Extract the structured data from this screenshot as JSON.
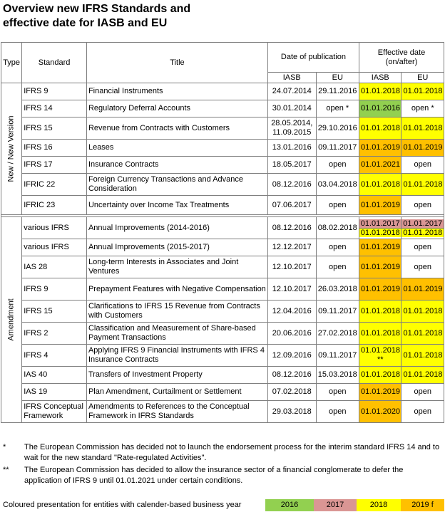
{
  "title_line1": "Overview new IFRS Standards and",
  "title_line2": "effective date for IASB and EU",
  "headers": {
    "type": "Type",
    "standard": "Standard",
    "title": "Title",
    "pub": "Date of publication",
    "eff": "Effective date (on/after)",
    "iasb": "IASB",
    "eu": "EU"
  },
  "groups": {
    "new": "New / New Version",
    "amend": "Amendment"
  },
  "colors": {
    "2016": "#92d050",
    "2017": "#da9694",
    "2018": "#ffff00",
    "2019f": "#ffc000"
  },
  "rows_new": [
    {
      "std": "IFRS 9",
      "title": "Financial Instruments",
      "pub_iasb": "24.07.2014",
      "pub_eu": "29.11.2016",
      "eff_iasb": "01.01.2018",
      "eff_iasb_c": "y2018",
      "eff_eu": "01.01.2018",
      "eff_eu_c": "y2018"
    },
    {
      "std": "IFRS 14",
      "title": "Regulatory Deferral Accounts",
      "pub_iasb": "30.01.2014",
      "pub_eu": "open *",
      "eff_iasb": "01.01.2016",
      "eff_iasb_c": "y2016",
      "eff_eu": "open *",
      "eff_eu_c": ""
    },
    {
      "std": "IFRS 15",
      "title": "Revenue from Contracts with Customers",
      "pub_iasb": "28.05.2014, 11.09.2015",
      "pub_eu": "29.10.2016",
      "eff_iasb": "01.01.2018",
      "eff_iasb_c": "y2018",
      "eff_eu": "01.01.2018",
      "eff_eu_c": "y2018"
    },
    {
      "std": "IFRS 16",
      "title": "Leases",
      "pub_iasb": "13.01.2016",
      "pub_eu": "09.11.2017",
      "eff_iasb": "01.01.2019",
      "eff_iasb_c": "y2019",
      "eff_eu": "01.01.2019",
      "eff_eu_c": "y2019"
    },
    {
      "std": "IFRS 17",
      "title": "Insurance Contracts",
      "pub_iasb": "18.05.2017",
      "pub_eu": "open",
      "eff_iasb": "01.01.2021",
      "eff_iasb_c": "y2021",
      "eff_eu": "open",
      "eff_eu_c": ""
    },
    {
      "std": "IFRIC 22",
      "title": "Foreign Currency Transactions and Advance Consideration",
      "pub_iasb": "08.12.2016",
      "pub_eu": "03.04.2018",
      "eff_iasb": "01.01.2018",
      "eff_iasb_c": "y2018",
      "eff_eu": "01.01.2018",
      "eff_eu_c": "y2018"
    },
    {
      "std": "IFRIC 23",
      "title": "Uncertainty over Income Tax Treatments",
      "pub_iasb": "07.06.2017",
      "pub_eu": "open",
      "eff_iasb": "01.01.2019",
      "eff_iasb_c": "y2019",
      "eff_eu": "open",
      "eff_eu_c": ""
    }
  ],
  "row_ai1416": {
    "std": "various IFRS",
    "title": "Annual Improvements (2014-2016)",
    "pub_iasb": "08.12.2016",
    "pub_eu": "08.02.2018",
    "eff_iasb_a": "01.01.2017",
    "eff_iasb_b": "01.01.2018",
    "eff_eu_a": "01.01.2017",
    "eff_eu_b": "01.01.2018"
  },
  "rows_amend": [
    {
      "std": "various IFRS",
      "title": "Annual Improvements (2015-2017)",
      "pub_iasb": "12.12.2017",
      "pub_eu": "open",
      "eff_iasb": "01.01.2019",
      "eff_iasb_c": "y2019",
      "eff_eu": "open",
      "eff_eu_c": ""
    },
    {
      "std": "IAS 28",
      "title": "Long-term Interests in Associates and Joint Ventures",
      "pub_iasb": "12.10.2017",
      "pub_eu": "open",
      "eff_iasb": "01.01.2019",
      "eff_iasb_c": "y2019",
      "eff_eu": "open",
      "eff_eu_c": ""
    },
    {
      "std": "IFRS 9",
      "title": "Prepayment Features with Negative Compensation",
      "pub_iasb": "12.10.2017",
      "pub_eu": "26.03.2018",
      "eff_iasb": "01.01.2019",
      "eff_iasb_c": "y2019",
      "eff_eu": "01.01.2019",
      "eff_eu_c": "y2019"
    },
    {
      "std": "IFRS 15",
      "title": "Clarifications to IFRS 15 Revenue from Contracts with Customers",
      "pub_iasb": "12.04.2016",
      "pub_eu": "09.11.2017",
      "eff_iasb": "01.01.2018",
      "eff_iasb_c": "y2018",
      "eff_eu": "01.01.2018",
      "eff_eu_c": "y2018"
    },
    {
      "std": "IFRS 2",
      "title": "Classification and Measurement of Share-based Payment Transactions",
      "pub_iasb": "20.06.2016",
      "pub_eu": "27.02.2018",
      "eff_iasb": "01.01.2018",
      "eff_iasb_c": "y2018",
      "eff_eu": "01.01.2018",
      "eff_eu_c": "y2018"
    },
    {
      "std": "IFRS 4",
      "title": "Applying IFRS 9 Financial Instruments with IFRS 4 Insurance Contracts",
      "pub_iasb": "12.09.2016",
      "pub_eu": "09.11.2017",
      "eff_iasb": "01.01.2018 **",
      "eff_iasb_c": "y2018",
      "eff_eu": "01.01.2018",
      "eff_eu_c": "y2018"
    },
    {
      "std": "IAS 40",
      "title": "Transfers of Investment Property",
      "pub_iasb": "08.12.2016",
      "pub_eu": "15.03.2018",
      "eff_iasb": "01.01.2018",
      "eff_iasb_c": "y2018",
      "eff_eu": "01.01.2018",
      "eff_eu_c": "y2018"
    },
    {
      "std": "IAS 19",
      "title": "Plan Amendment, Curtailment or Settlement",
      "pub_iasb": "07.02.2018",
      "pub_eu": "open",
      "eff_iasb": "01.01.2019",
      "eff_iasb_c": "y2019",
      "eff_eu": "open",
      "eff_eu_c": ""
    },
    {
      "std": "IFRS Conceptual Framework",
      "title": "Amendments to References to the Conceptual Framework in IFRS Standards",
      "pub_iasb": "29.03.2018",
      "pub_eu": "open",
      "eff_iasb": "01.01.2020",
      "eff_iasb_c": "y2020",
      "eff_eu": "open",
      "eff_eu_c": ""
    }
  ],
  "note1_mark": "*",
  "note1": "The European Commission has decided not to launch the endorsement process for the interim standard IFRS 14 and to wait for the new standard \"Rate-regulated Activities\".",
  "note2_mark": "**",
  "note2": "The European Commission has decided to allow the insurance sector of a financial conglomerate to defer the application of IFRS 9 until 01.01.2021 under certain conditions.",
  "legend": {
    "label": "Coloured presentation for entities with calender-based business year",
    "y2016": "2016",
    "y2017": "2017",
    "y2018": "2018",
    "y2019": "2019 f"
  }
}
